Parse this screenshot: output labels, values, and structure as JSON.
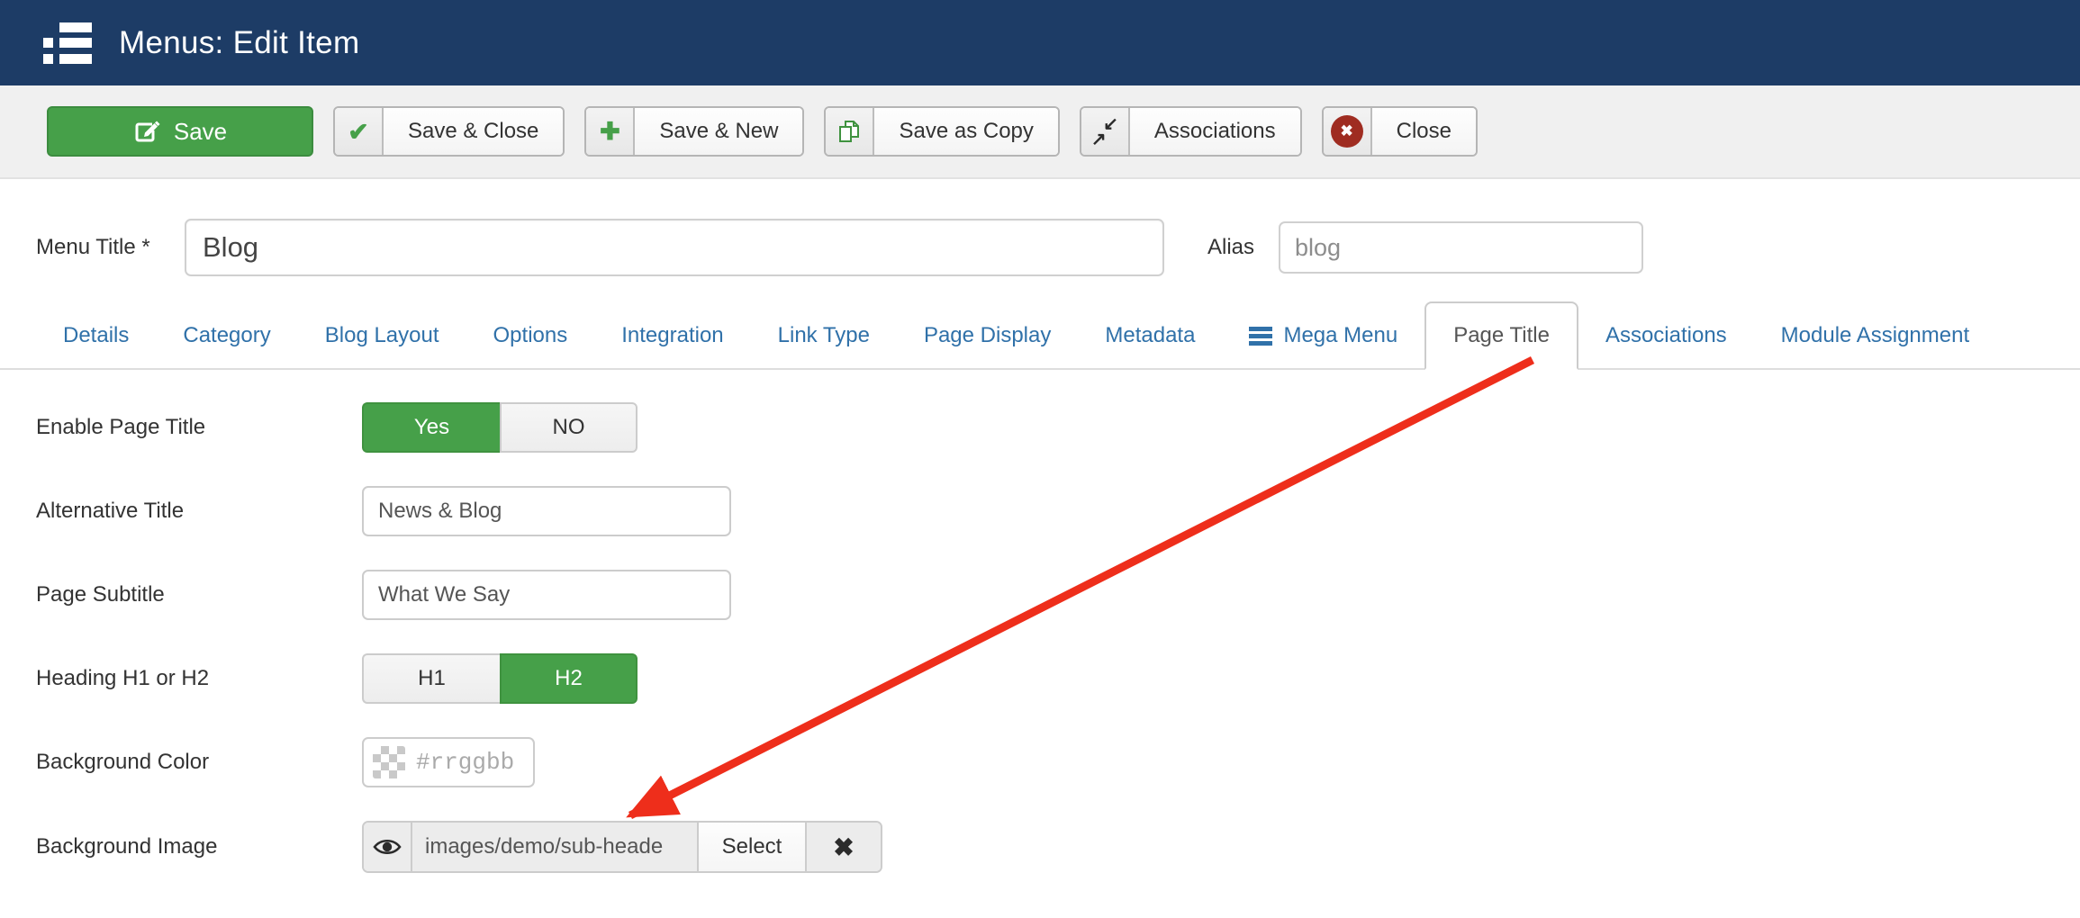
{
  "colors": {
    "header_bg": "#1d3c66",
    "toolbar_bg": "#f0f0f0",
    "accent_green": "#46a049",
    "tab_link_blue": "#3071a9",
    "close_badge_red": "#9f2c21",
    "arrow_red": "#ee2e1b"
  },
  "header": {
    "title": "Menus: Edit Item"
  },
  "toolbar": {
    "buttons": [
      {
        "label": "Save",
        "icon": "save-edit-icon"
      },
      {
        "label": "Save & Close",
        "icon": "check-icon",
        "glyph": "✔"
      },
      {
        "label": "Save & New",
        "icon": "plus-icon",
        "glyph": "✚"
      },
      {
        "label": "Save as Copy",
        "icon": "copy-icon"
      },
      {
        "label": "Associations",
        "icon": "contract-icon",
        "glyph_a": "↙",
        "glyph_b": "↗"
      },
      {
        "label": "Close",
        "icon": "close-circle-icon",
        "glyph": "✖"
      }
    ]
  },
  "fields": {
    "menu_title": {
      "label": "Menu Title *",
      "value": "Blog"
    },
    "alias": {
      "label": "Alias",
      "value": "blog"
    }
  },
  "tabs": {
    "active_tab": "Page Title",
    "items": [
      {
        "label": "Details"
      },
      {
        "label": "Category"
      },
      {
        "label": "Blog Layout"
      },
      {
        "label": "Options"
      },
      {
        "label": "Integration"
      },
      {
        "label": "Link Type"
      },
      {
        "label": "Page Display"
      },
      {
        "label": "Metadata"
      },
      {
        "label": "Mega Menu",
        "icon": "menu-bars-icon"
      },
      {
        "label": "Page Title"
      },
      {
        "label": "Associations"
      },
      {
        "label": "Module Assignment"
      }
    ]
  },
  "form": {
    "enable_page_title": {
      "label": "Enable Page Title",
      "options": [
        "Yes",
        "NO"
      ],
      "selected": "Yes"
    },
    "alternative_title": {
      "label": "Alternative Title",
      "value": "News & Blog"
    },
    "page_subtitle": {
      "label": "Page Subtitle",
      "value": "What We Say"
    },
    "heading": {
      "label": "Heading H1 or H2",
      "options": [
        "H1",
        "H2"
      ],
      "selected": "H2"
    },
    "background_color": {
      "label": "Background Color",
      "placeholder": "#rrggbb"
    },
    "background_image": {
      "label": "Background Image",
      "value": "images/demo/sub-heade",
      "select_label": "Select",
      "clear_glyph": "✖",
      "icon": "eye-icon"
    }
  }
}
